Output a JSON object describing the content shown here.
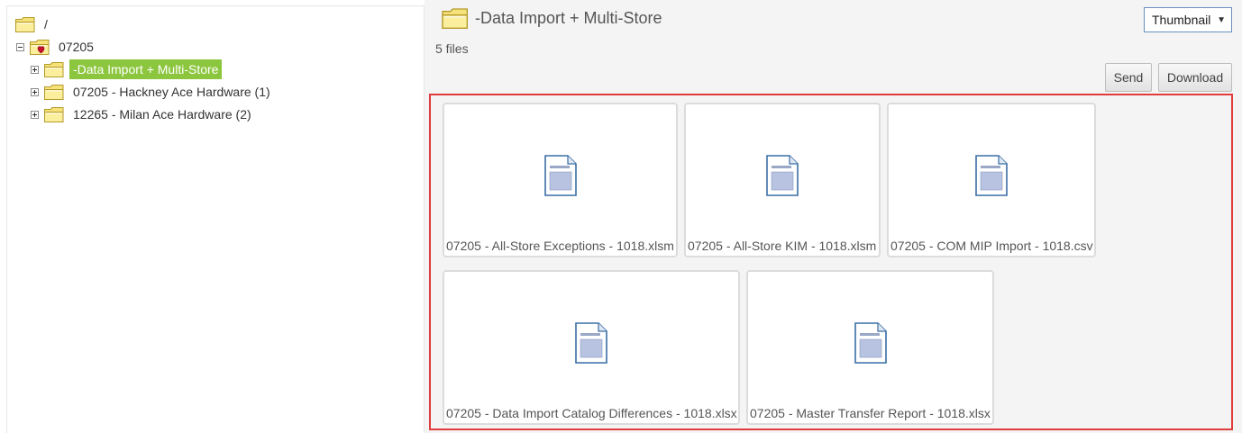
{
  "tree": {
    "root_label": "/",
    "store_label": "07205",
    "children": [
      {
        "label": "-Data Import + Multi-Store",
        "selected": true
      },
      {
        "label": "07205 - Hackney Ace Hardware (1)",
        "selected": false
      },
      {
        "label": "12265 - Milan Ace Hardware (2)",
        "selected": false
      }
    ]
  },
  "content": {
    "title": "-Data Import + Multi-Store",
    "file_count": "5 files",
    "view_mode": "Thumbnail",
    "caret": "▼",
    "send_label": "Send",
    "download_label": "Download"
  },
  "files": [
    {
      "name": "07205 - All-Store Exceptions - 1018.xlsm",
      "icon": "document-icon"
    },
    {
      "name": "07205 - All-Store KIM - 1018.xlsm",
      "icon": "document-icon"
    },
    {
      "name": "07205 - COM MIP Import - 1018.csv",
      "icon": "document-icon"
    },
    {
      "name": "07205 - Data Import Catalog Differences - 1018.xlsx",
      "icon": "document-icon"
    },
    {
      "name": "07205 - Master Transfer Report - 1018.xlsx",
      "icon": "document-icon"
    }
  ],
  "colors": {
    "selection": "#8cc63e",
    "grid_border": "#e03c3c",
    "folder": "#f5d547",
    "accent_red": "#c8102e"
  }
}
